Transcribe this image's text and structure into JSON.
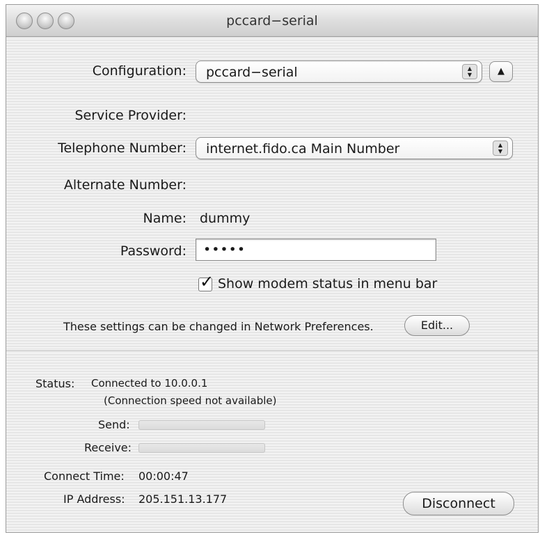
{
  "window": {
    "title": "pccard−serial"
  },
  "form": {
    "configuration": {
      "label": "Configuration:",
      "value": "pccard−serial"
    },
    "service_provider": {
      "label": "Service Provider:",
      "value": ""
    },
    "telephone_number": {
      "label": "Telephone Number:",
      "value": "internet.fido.ca Main Number"
    },
    "alternate_number": {
      "label": "Alternate Number:",
      "value": ""
    },
    "name": {
      "label": "Name:",
      "value": "dummy"
    },
    "password": {
      "label": "Password:",
      "value": "•••••"
    },
    "show_modem_status": {
      "label": "Show modem status in menu bar",
      "checked": true
    },
    "settings_note": "These settings can be changed in Network Preferences.",
    "edit_button": "Edit..."
  },
  "status": {
    "label": "Status:",
    "line1": "Connected to 10.0.0.1",
    "line2": "(Connection speed not available)",
    "send_label": "Send:",
    "send_level": 0,
    "receive_label": "Receive:",
    "receive_level": 0,
    "connect_time_label": "Connect Time:",
    "connect_time": "00:00:47",
    "ip_address_label": "IP Address:",
    "ip_address": "205.151.13.177",
    "disconnect_button": "Disconnect"
  },
  "icons": {
    "popup_arrows": "up-down-chevron-icon",
    "collapse": "triangle-up-icon",
    "check": "checkmark-icon"
  }
}
